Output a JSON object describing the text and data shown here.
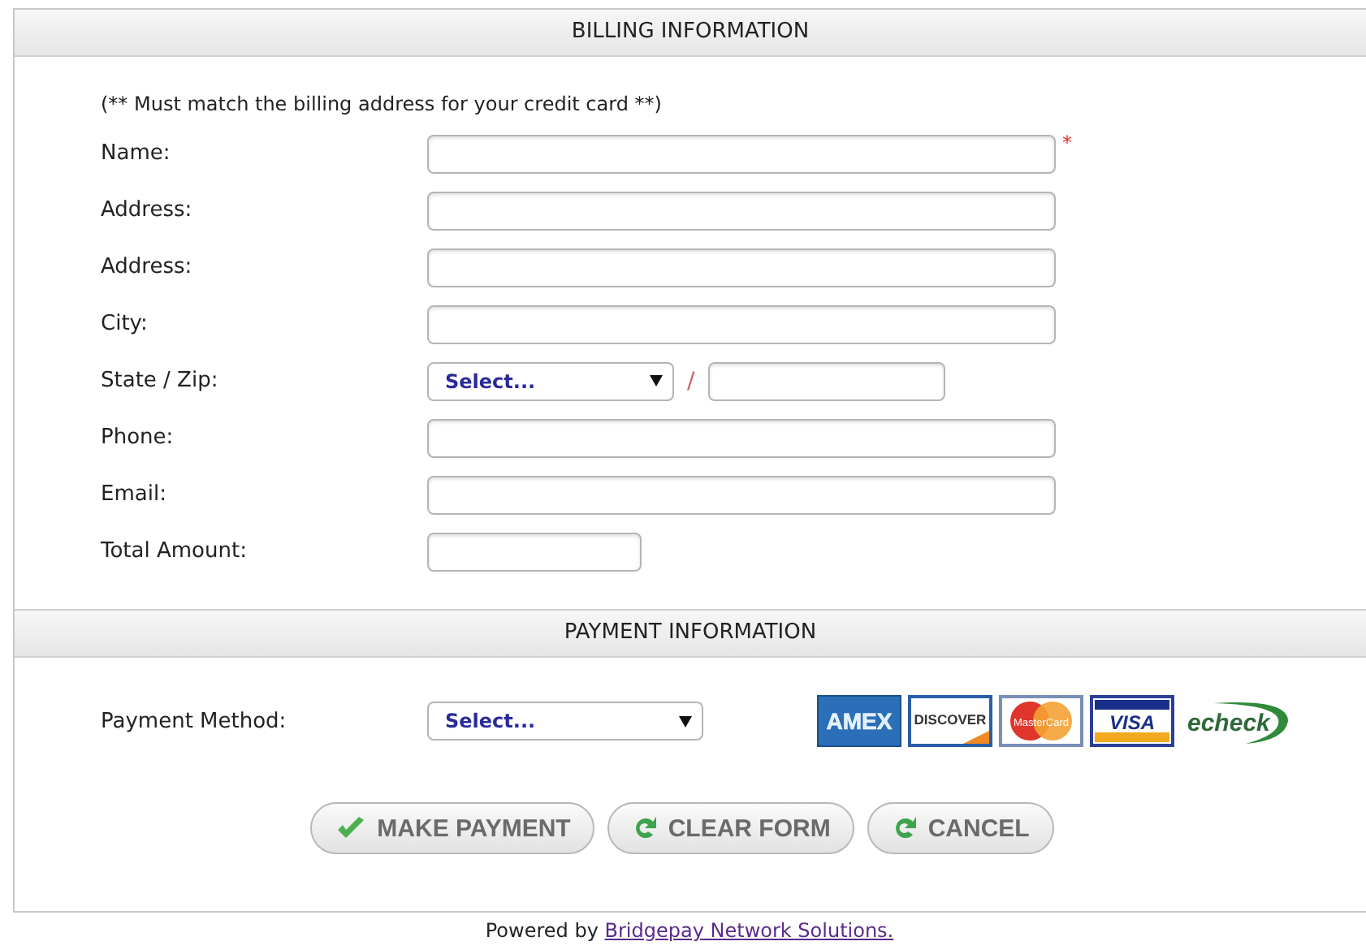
{
  "billing": {
    "title": "BILLING INFORMATION",
    "note": "(** Must match the billing address for your credit card **)",
    "fields": [
      {
        "kind": "text",
        "label": "Name:",
        "required": true
      },
      {
        "kind": "text",
        "label": "Address:",
        "required": false
      },
      {
        "kind": "text",
        "label": "Address:",
        "required": false
      },
      {
        "kind": "text",
        "label": "City:",
        "required": false
      },
      {
        "kind": "state_zip",
        "label": "State / Zip:",
        "required": false,
        "select_value": "Select...",
        "separator": "/"
      },
      {
        "kind": "text",
        "label": "Phone:",
        "required": false
      },
      {
        "kind": "text",
        "label": "Email:",
        "required": false
      },
      {
        "kind": "short",
        "label": "Total Amount:",
        "required": false
      }
    ],
    "required_mark": "*"
  },
  "payment": {
    "title": "PAYMENT INFORMATION",
    "method_label": "Payment Method:",
    "method_value": "Select...",
    "logos": [
      {
        "kind": "amex",
        "label": "AMEX"
      },
      {
        "kind": "discover",
        "label": "DISCOVER"
      },
      {
        "kind": "mastercard",
        "label": "MasterCard"
      },
      {
        "kind": "visa",
        "label": "VISA"
      },
      {
        "kind": "echeck",
        "label": "echeck"
      }
    ]
  },
  "buttons": [
    {
      "kind": "check",
      "label": "MAKE PAYMENT"
    },
    {
      "kind": "refresh",
      "label": "CLEAR FORM"
    },
    {
      "kind": "refresh",
      "label": "CANCEL"
    }
  ],
  "footer": {
    "prefix": "Powered by",
    "link": "Bridgepay Network Solutions."
  }
}
